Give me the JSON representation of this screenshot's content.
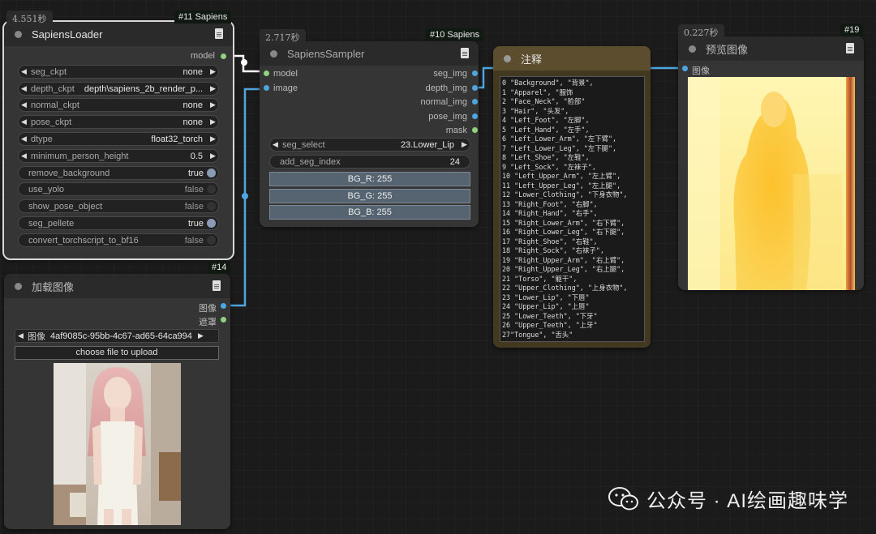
{
  "nodes": {
    "loader": {
      "timer": "4.551秒",
      "badge": "#11 Sapiens",
      "title": "SapiensLoader",
      "output": "model",
      "widgets": [
        {
          "name": "seg_ckpt",
          "value": "none"
        },
        {
          "name": "depth_ckpt",
          "value": "depth\\sapiens_2b_render_p..."
        },
        {
          "name": "normal_ckpt",
          "value": "none"
        },
        {
          "name": "pose_ckpt",
          "value": "none"
        },
        {
          "name": "dtype",
          "value": "float32_torch"
        },
        {
          "name": "minimum_person_height",
          "value": "0.5"
        }
      ],
      "toggles": [
        {
          "name": "remove_background",
          "value": "true"
        },
        {
          "name": "use_yolo",
          "value": "false"
        },
        {
          "name": "show_pose_object",
          "value": "false"
        },
        {
          "name": "seg_pellete",
          "value": "true"
        },
        {
          "name": "convert_torchscript_to_bf16",
          "value": "false"
        }
      ]
    },
    "sampler": {
      "timer": "2.717秒",
      "badge": "#10 Sapiens",
      "title": "SapiensSampler",
      "inputs": [
        "model",
        "image"
      ],
      "outputs": [
        "seg_img",
        "depth_img",
        "normal_img",
        "pose_img",
        "mask"
      ],
      "seg_select": {
        "name": "seg_select",
        "value": "23.Lower_Lip"
      },
      "add_seg_index": {
        "name": "add_seg_index",
        "value": "24"
      },
      "buttons": [
        "BG_R: 255",
        "BG_G: 255",
        "BG_B: 255"
      ]
    },
    "note": {
      "title": "注释",
      "text": "0 \"Background\", \"背景\",\n1 \"Apparel\", \"服饰\n2 \"Face_Neck\", \"脸部\"\n3 \"Hair\", \"头发\",\n4 \"Left_Foot\", \"左脚\",\n5 \"Left_Hand\", \"左手\",\n6 \"Left_Lower_Arm\", \"左下臂\",\n7 \"Left_Lower_Leg\", \"左下腿\",\n8 \"Left_Shoe\", \"左鞋\",\n9 \"Left_Sock\", \"左袜子\",\n10 \"Left_Upper_Arm\", \"左上臂\",\n11 \"Left_Upper_Leg\", \"左上腿\",\n12 \"Lower_Clothing\", \"下身衣物\",\n13 \"Right_Foot\", \"右脚\",\n14 \"Right_Hand\", \"右手\",\n15 \"Right_Lower_Arm\", \"右下臂\",\n16 \"Right_Lower_Leg\", \"右下腿\",\n17 \"Right_Shoe\", \"右鞋\",\n18 \"Right_Sock\", \"右袜子\",\n19 \"Right_Upper_Arm\", \"右上臂\",\n20 \"Right_Upper_Leg\", \"右上腿\",\n21 \"Torso\", \"躯干\",\n22 \"Upper_Clothing\", \"上身衣物\",\n23 \"Lower_Lip\", \"下唇\"\n24 \"Upper_Lip\", \"上唇\"\n25 \"Lower_Teeth\", \"下牙\"\n26 \"Upper_Teeth\", \"上牙\"\n27\"Tongue\", \"舌头\""
    },
    "preview": {
      "timer": "0.227秒",
      "badge": "#19",
      "title": "预览图像",
      "input": "图像"
    },
    "load_image": {
      "badge": "#14",
      "title": "加载图像",
      "outputs": [
        "图像",
        "遮罩"
      ],
      "image_widget": {
        "name": "图像",
        "value": "4af9085c-95bb-4c67-ad65-64ca994..."
      },
      "upload_label": "choose file to upload"
    }
  },
  "watermark": "公众号 · AI绘画趣味学",
  "colors": {
    "canvas": "#1b1b1b",
    "node_body": "#353535",
    "node_header": "#2a2a2a",
    "note_body": "#433920",
    "note_header": "#5b4d2d",
    "wire_blue": "#4ea6e0",
    "wire_white": "#ffffff",
    "slot_green": "#8fd37f",
    "slot_blue": "#4ea6e0",
    "button_blue": "#556470"
  }
}
